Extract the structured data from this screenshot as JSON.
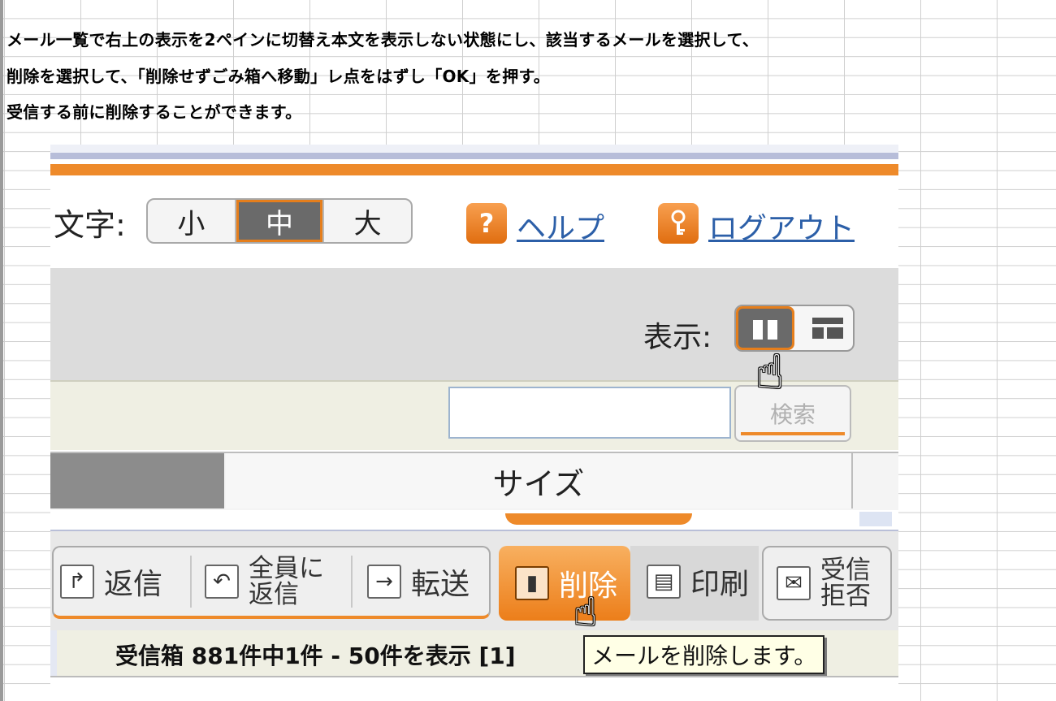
{
  "instructions": {
    "line1": "メール一覧で右上の表示を2ペインに切替え本文を表示しない状態にし、該当するメールを選択して、",
    "line2": "削除を選択して、「削除せずごみ箱へ移動」レ点をはずし「OK」を押す。",
    "line3": "受信する前に削除することができます。"
  },
  "header": {
    "font_label": "文字:",
    "font_sizes": [
      "小",
      "中",
      "大"
    ],
    "font_selected": "中",
    "help_icon": "?",
    "help_label": "ヘルプ",
    "logout_icon": "key-icon",
    "logout_label": "ログアウト"
  },
  "view": {
    "label": "表示:",
    "options": [
      "2-pane-icon",
      "3-pane-icon"
    ],
    "selected": "2-pane-icon"
  },
  "search": {
    "value": "",
    "button_label": "検索"
  },
  "columns": {
    "size_label": "サイズ"
  },
  "toolbar": {
    "reply": "返信",
    "reply_all_line1": "全員に",
    "reply_all_line2": "返信",
    "forward": "転送",
    "delete": "削除",
    "print": "印刷",
    "reject_line1": "受信",
    "reject_line2": "拒否"
  },
  "status": {
    "text": "受信箱 881件中1件 - 50件を表示 [1]"
  },
  "tooltip": {
    "text": "メールを削除します。"
  },
  "colors": {
    "accent": "#ee8a2a",
    "link": "#2c5fa8"
  }
}
